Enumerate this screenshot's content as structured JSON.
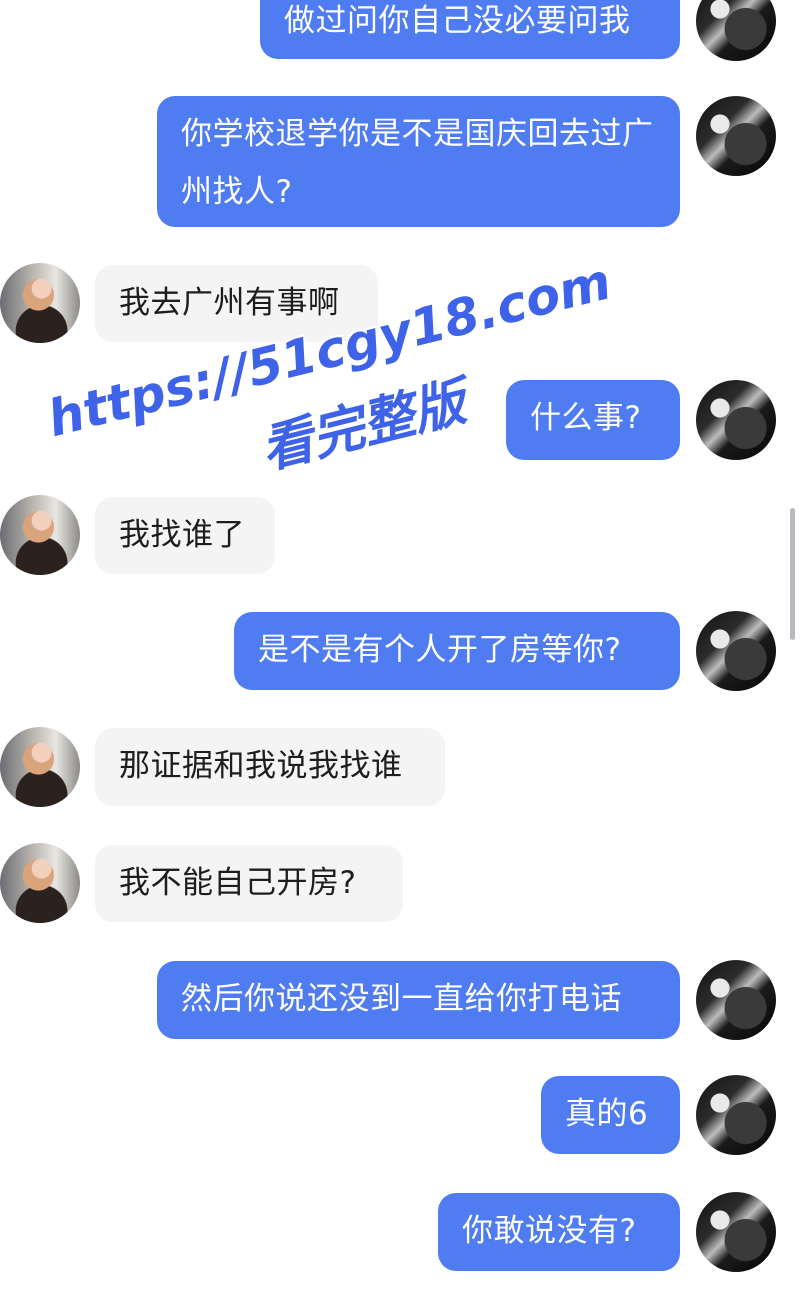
{
  "messages": [
    {
      "side": "me",
      "text": "做过问你自己没必要问我"
    },
    {
      "side": "me",
      "text": "你学校退学你是不是国庆回去过广州找人?"
    },
    {
      "side": "them",
      "text": "我去广州有事啊"
    },
    {
      "side": "me",
      "text": "什么事?"
    },
    {
      "side": "them",
      "text": "我找谁了"
    },
    {
      "side": "me",
      "text": "是不是有个人开了房等你?"
    },
    {
      "side": "them",
      "text": "那证据和我说我找谁"
    },
    {
      "side": "them",
      "text": "我不能自己开房?"
    },
    {
      "side": "me",
      "text": "然后你说还没到一直给你打电话"
    },
    {
      "side": "me",
      "text": "真的6"
    },
    {
      "side": "me",
      "text": "你敢说没有?"
    }
  ],
  "watermark": {
    "url": "https://51cgy18.com",
    "subtitle": "看完整版"
  },
  "colors": {
    "outgoing_bubble": "#4f7cf0",
    "incoming_bubble": "#f4f4f5",
    "watermark": "#3f63e8"
  }
}
